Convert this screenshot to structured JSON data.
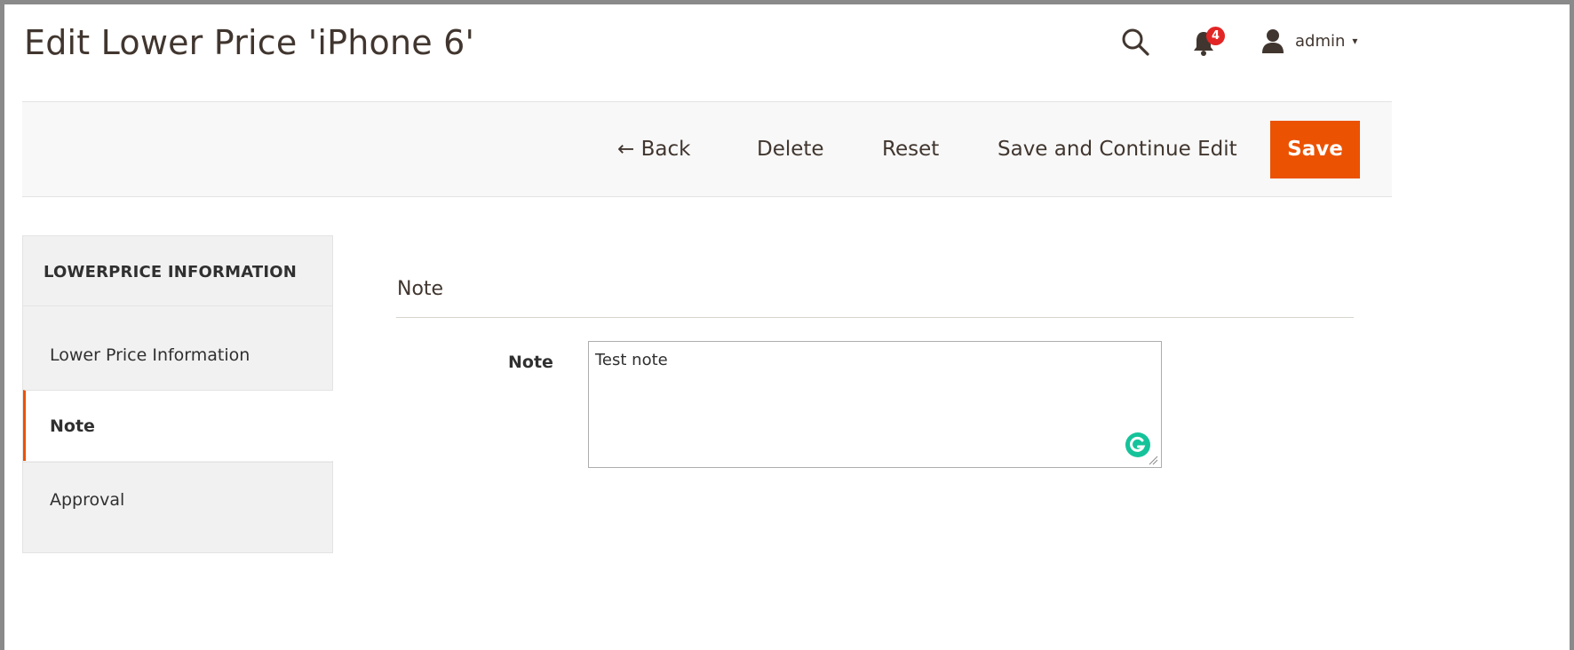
{
  "header": {
    "title": "Edit Lower Price 'iPhone 6'",
    "search_icon": "search-icon",
    "notifications": {
      "icon": "bell-icon",
      "count": "4"
    },
    "user_menu": {
      "icon": "user-icon",
      "label": "admin",
      "caret": "▾"
    }
  },
  "toolbar": {
    "back_label": "← Back",
    "delete_label": "Delete",
    "reset_label": "Reset",
    "save_continue_label": "Save and Continue Edit",
    "save_label": "Save"
  },
  "sidebar": {
    "title": "LOWERPRICE INFORMATION",
    "items": [
      {
        "label": "Lower Price Information",
        "active": false
      },
      {
        "label": "Note",
        "active": true
      },
      {
        "label": "Approval",
        "active": false
      }
    ]
  },
  "main": {
    "section_title": "Note",
    "note_field": {
      "label": "Note",
      "value": "Test note",
      "icon": "grammarly-icon"
    }
  },
  "colors": {
    "accent": "#eb5202",
    "badge": "#e22626",
    "toolbar_bg": "#f8f8f8",
    "sidebar_bg": "#f1f1f1",
    "grammarly": "#15c39a"
  }
}
